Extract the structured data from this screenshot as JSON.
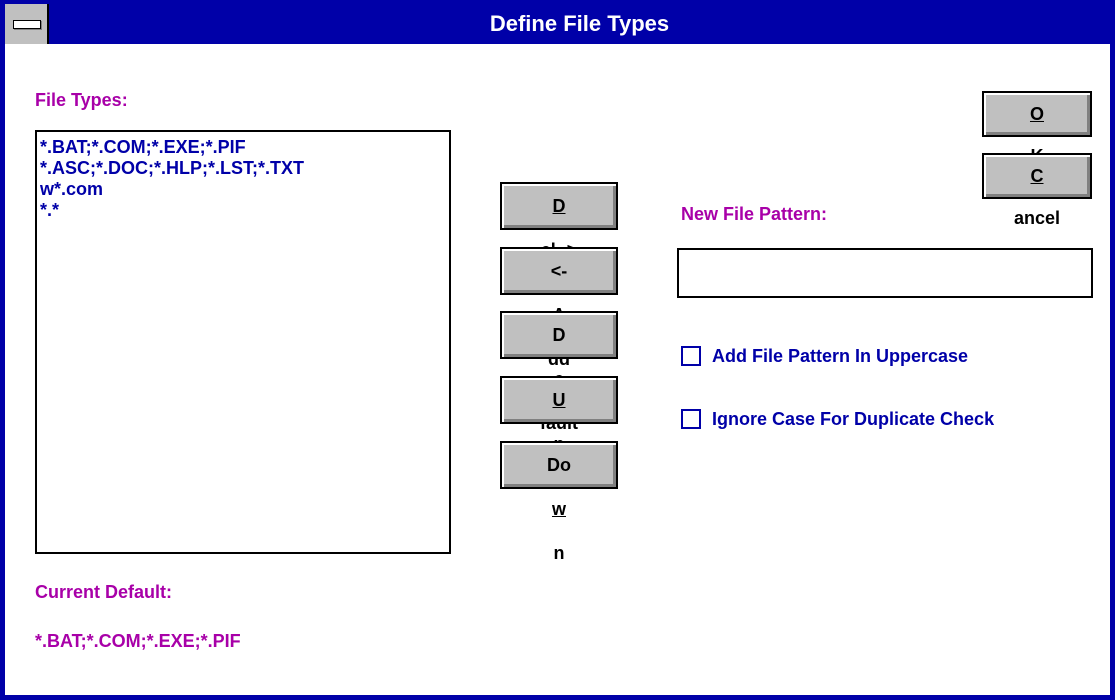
{
  "window": {
    "title": "Define File Types"
  },
  "labels": {
    "file_types": "File Types:",
    "new_file_pattern": "New File Pattern:",
    "current_default": "Current Default:"
  },
  "file_types": [
    "*.BAT;*.COM;*.EXE;*.PIF",
    "*.ASC;*.DOC;*.HLP;*.LST;*.TXT",
    "w*.com",
    "*.*"
  ],
  "current_default_value": "*.BAT;*.COM;*.EXE;*.PIF",
  "buttons": {
    "ok": {
      "mnemonic": "O",
      "rest": "K"
    },
    "cancel": {
      "mnemonic": "C",
      "rest": "ancel"
    },
    "del": {
      "mnemonic": "D",
      "rest": "el ->"
    },
    "add": {
      "pre": "<- ",
      "mnemonic": "A",
      "rest": "dd"
    },
    "default": {
      "pre": "D",
      "mnemonic": "e",
      "rest": "fault"
    },
    "up": {
      "mnemonic": "U",
      "rest": "p"
    },
    "down": {
      "pre": "Do",
      "mnemonic": "w",
      "rest": "n"
    }
  },
  "new_file_pattern_value": "",
  "checkboxes": {
    "uppercase": {
      "label": "Add File Pattern In Uppercase",
      "checked": false
    },
    "ignore_case": {
      "label": "Ignore Case For Duplicate Check",
      "checked": false
    }
  }
}
